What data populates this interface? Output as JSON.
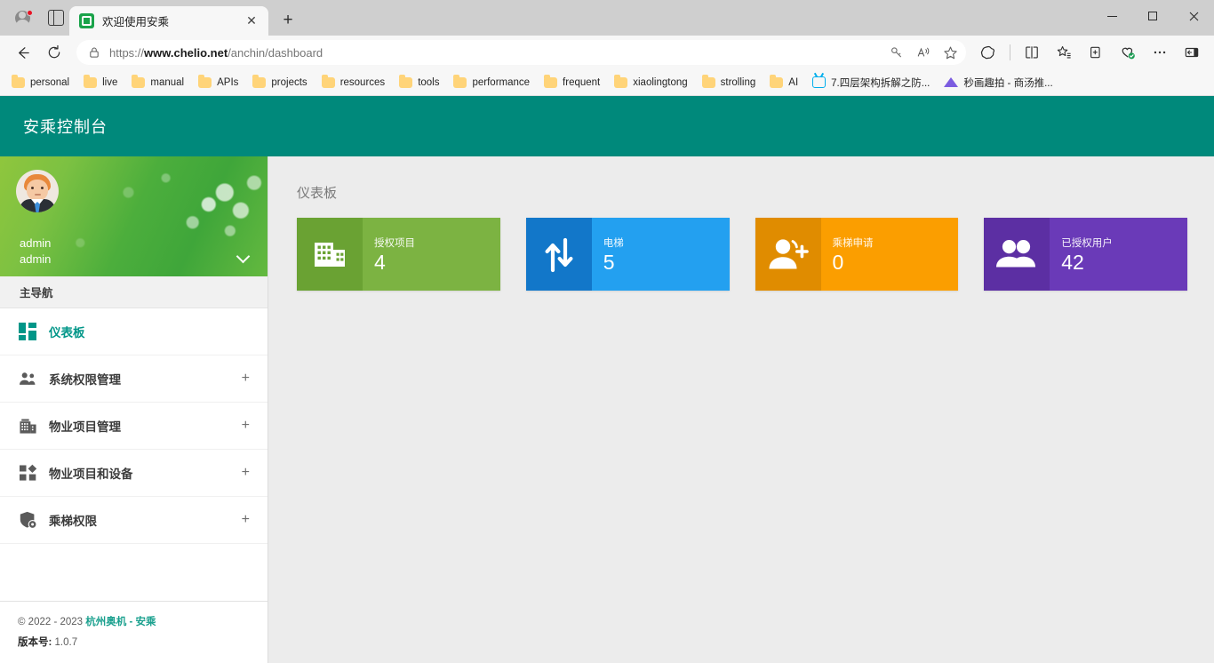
{
  "browser": {
    "tab": {
      "title": "欢迎使用安乘",
      "close_label": "✕"
    },
    "new_tab_label": "+",
    "window_controls": {
      "minimize": "—",
      "maximize": "▢",
      "close": "✕"
    },
    "omnibox": {
      "url_scheme": "https://",
      "url_host": "www.chelio.net",
      "url_path": "/anchin/dashboard",
      "full_url": "https://www.chelio.net/anchin/dashboard"
    },
    "bookmarks": [
      {
        "label": "personal",
        "icon": "folder-icon"
      },
      {
        "label": "live",
        "icon": "folder-icon"
      },
      {
        "label": "manual",
        "icon": "folder-icon"
      },
      {
        "label": "APIs",
        "icon": "folder-icon"
      },
      {
        "label": "projects",
        "icon": "folder-icon"
      },
      {
        "label": "resources",
        "icon": "folder-icon"
      },
      {
        "label": "tools",
        "icon": "folder-icon"
      },
      {
        "label": "performance",
        "icon": "folder-icon"
      },
      {
        "label": "frequent",
        "icon": "folder-icon"
      },
      {
        "label": "xiaolingtong",
        "icon": "folder-icon"
      },
      {
        "label": "strolling",
        "icon": "folder-icon"
      },
      {
        "label": "AI",
        "icon": "folder-icon"
      },
      {
        "label": "7.四层架构拆解之防...",
        "icon": "bilibili-icon"
      },
      {
        "label": "秒画趣拍 - 商汤推...",
        "icon": "mountain-icon"
      }
    ]
  },
  "app": {
    "header": {
      "title": "安乘控制台",
      "background": "#00897b"
    },
    "profile": {
      "name": "admin",
      "role": "admin",
      "avatar_alt": "admin-avatar",
      "caret": "chevron-down-icon"
    },
    "sidebar": {
      "section_label": "主导航",
      "items": [
        {
          "label": "仪表板",
          "icon": "dashboard-grid-icon",
          "active": true,
          "expand": ""
        },
        {
          "label": "系统权限管理",
          "icon": "users-icon",
          "active": false,
          "expand": "+"
        },
        {
          "label": "物业项目管理",
          "icon": "building-icon",
          "active": false,
          "expand": "+"
        },
        {
          "label": "物业项目和设备",
          "icon": "grid-device-icon",
          "active": false,
          "expand": "+"
        },
        {
          "label": "乘梯权限",
          "icon": "shield-gear-icon",
          "active": false,
          "expand": "+"
        }
      ],
      "footer": {
        "copyright_prefix": "© 2022 - 2023 ",
        "copyright_link": "杭州奥机 - 安乘",
        "version_label": "版本号:",
        "version_value": " 1.0.7"
      }
    },
    "main": {
      "page_title": "仪表板",
      "cards": [
        {
          "label": "授权项目",
          "value": "4",
          "icon": "building-card-icon",
          "color": "#7cb342",
          "icon_color": "#6aa233"
        },
        {
          "label": "电梯",
          "value": "5",
          "icon": "elevator-arrows-icon",
          "color": "#23a0f0",
          "icon_color": "#1277c9"
        },
        {
          "label": "乘梯申请",
          "value": "0",
          "icon": "user-add-icon",
          "color": "#fb9e00",
          "icon_color": "#e08c00"
        },
        {
          "label": "已授权用户",
          "value": "42",
          "icon": "users-card-icon",
          "color": "#6a3ab8",
          "icon_color": "#5c2fa3"
        }
      ]
    }
  }
}
